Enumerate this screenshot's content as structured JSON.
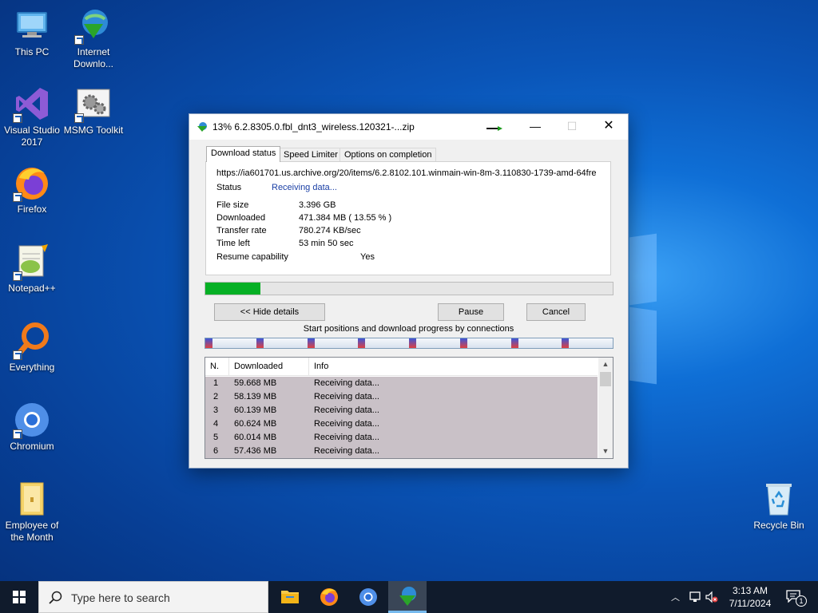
{
  "desktop": {
    "icons": [
      {
        "label": "This PC"
      },
      {
        "label": "Internet Downlo..."
      },
      {
        "label": "Visual Studio 2017"
      },
      {
        "label": "MSMG Toolkit"
      },
      {
        "label": "Firefox"
      },
      {
        "label": "Notepad++"
      },
      {
        "label": "Everything"
      },
      {
        "label": "Chromium"
      },
      {
        "label": "Employee of the Month"
      },
      {
        "label": "Recycle Bin"
      }
    ]
  },
  "window": {
    "title": "13% 6.2.8305.0.fbl_dnt3_wireless.120321-...zip",
    "controls": {
      "minimize": "—",
      "maximize": "☐",
      "close": "✕"
    },
    "tabs": [
      "Download status",
      "Speed Limiter",
      "Options on completion"
    ],
    "active_tab": "Download status",
    "url": "https://ia601701.us.archive.org/20/items/6.2.8102.101.winmain-win-8m-3.110830-1739-amd-64fre",
    "status_label": "Status",
    "status_value": "Receiving data...",
    "file_size_label": "File size",
    "file_size_value": "3.396  GB",
    "downloaded_label": "Downloaded",
    "downloaded_value": "471.384  MB  ( 13.55 % )",
    "transfer_rate_label": "Transfer rate",
    "transfer_rate_value": "780.274  KB/sec",
    "time_left_label": "Time left",
    "time_left_value": "53 min 50 sec",
    "resume_label": "Resume capability",
    "resume_value": "Yes",
    "progress_percent": 13.55,
    "progress_color": "#06b025",
    "buttons": {
      "hide_details": "<< Hide details",
      "pause": "Pause",
      "cancel": "Cancel"
    },
    "connections_caption": "Start positions and download progress by connections",
    "connections_count": 8,
    "list": {
      "headers": [
        "N.",
        "Downloaded",
        "Info"
      ],
      "rows": [
        {
          "n": "1",
          "downloaded": "59.668  MB",
          "info": "Receiving data..."
        },
        {
          "n": "2",
          "downloaded": "58.139  MB",
          "info": "Receiving data..."
        },
        {
          "n": "3",
          "downloaded": "60.139  MB",
          "info": "Receiving data..."
        },
        {
          "n": "4",
          "downloaded": "60.624  MB",
          "info": "Receiving data..."
        },
        {
          "n": "5",
          "downloaded": "60.014  MB",
          "info": "Receiving data..."
        },
        {
          "n": "6",
          "downloaded": "57.436  MB",
          "info": "Receiving data..."
        }
      ]
    }
  },
  "taskbar": {
    "search_placeholder": "Type here to search",
    "apps": [
      "file-explorer",
      "firefox",
      "chromium",
      "internet-download-manager"
    ],
    "time": "3:13 AM",
    "date": "7/11/2024",
    "notification_count": "1"
  }
}
